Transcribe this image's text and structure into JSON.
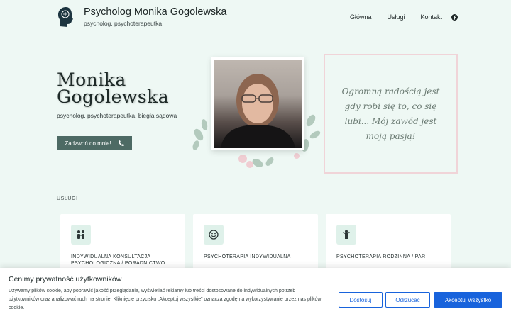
{
  "header": {
    "title": "Psycholog Monika Gogolewska",
    "subtitle": "psycholog, psychoterapeutka",
    "logo_icon": "head-brain-logo-icon",
    "nav": [
      "Główna",
      "Usługi",
      "Kontakt"
    ],
    "social_icon": "facebook-icon"
  },
  "hero": {
    "name_line1": "Monika",
    "name_line2": "Gogolewska",
    "role": "psycholog, psychoterapeutka, biegła sądowa",
    "call_button": "Zadzwoń do mnie!",
    "call_icon": "phone-icon",
    "quote": "Ogromną radością jest gdy robi się to, co się lubi... Mój zawód jest moją pasją!"
  },
  "services": {
    "label": "Usługi",
    "cards": [
      {
        "title": "INDYWIDUALNA KONSULTACJA PSYCHOLOGICZNA / PORADNICTWO",
        "icon": "people-icon"
      },
      {
        "title": "PSYCHOTERAPIA INDYWIDUALNA",
        "icon": "smiley-icon"
      },
      {
        "title": "PSYCHOTERAPIA RODZINNA / PAR",
        "icon": "person-icon"
      }
    ]
  },
  "cookie": {
    "title": "Cenimy prywatność użytkowników",
    "text": "Używamy plików cookie, aby poprawić jakość przeglądania, wyświetlać reklamy lub treści dostosowane do indywidualnych potrzeb użytkowników oraz analizować ruch na stronie. Kliknięcie przycisku „Akceptuj wszystkie” oznacza zgodę na wykorzystywanie przez nas plików cookie.",
    "customize": "Dostosuj",
    "reject": "Odrzucać",
    "accept": "Akceptuj wszystko"
  },
  "colors": {
    "background": "#eef8f4",
    "button_dark": "#4d6a64",
    "accent_blue": "#1863dc",
    "quote_border": "#f0d4d8"
  }
}
